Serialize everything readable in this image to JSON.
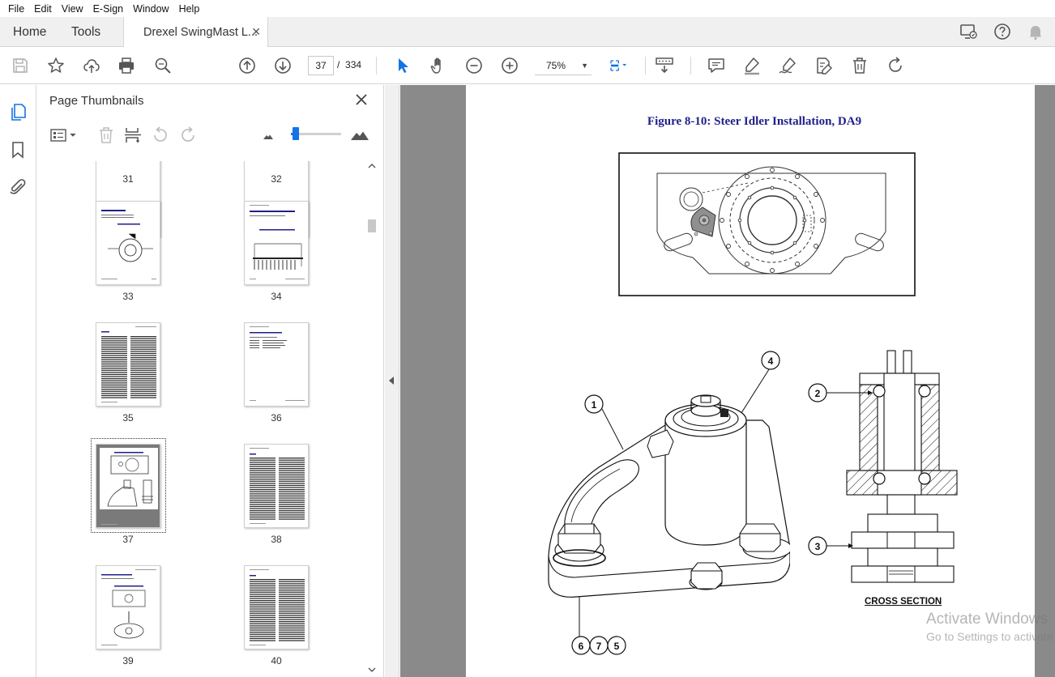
{
  "menu": {
    "items": [
      "File",
      "Edit",
      "View",
      "E-Sign",
      "Window",
      "Help"
    ]
  },
  "tabs": {
    "home": "Home",
    "tools": "Tools",
    "document": "Drexel SwingMast L...",
    "close": "✕"
  },
  "toolbar": {
    "current_page": "37",
    "page_separator": "/",
    "total_pages": "334",
    "zoom": "75%",
    "icons": [
      "save-icon",
      "bookmark-star-icon",
      "upload-icon",
      "print-icon",
      "find-icon",
      "prev-page-icon",
      "next-page-icon",
      "select-arrow-icon",
      "hand-icon",
      "zoom-out-icon",
      "zoom-in-icon",
      "fit-page-icon",
      "scroll-mode-icon",
      "comment-icon",
      "highlight-icon",
      "sign-icon",
      "fill-sign-icon",
      "delete-icon",
      "rotate-icon"
    ]
  },
  "panel": {
    "title": "Page Thumbnails",
    "close": "✕",
    "thumbnails": [
      {
        "page": "31"
      },
      {
        "page": "32"
      },
      {
        "page": "33"
      },
      {
        "page": "34"
      },
      {
        "page": "35"
      },
      {
        "page": "36"
      },
      {
        "page": "37",
        "selected": true
      },
      {
        "page": "38"
      },
      {
        "page": "39"
      },
      {
        "page": "40"
      }
    ],
    "thumbnail_size_fraction": 0.05
  },
  "document": {
    "figure_title": "Figure 8-10:  Steer Idler Installation, DA9",
    "cross_section_label": "CROSS SECTION",
    "callouts": [
      "1",
      "2",
      "3",
      "4",
      "5",
      "6",
      "7"
    ]
  },
  "watermark": {
    "line1": "Activate Windows",
    "line2": "Go to Settings to activate Windows."
  },
  "colors": {
    "accent": "#1473e6",
    "title_blue": "#1f1f8a",
    "doc_background": "#8a8a8a"
  }
}
